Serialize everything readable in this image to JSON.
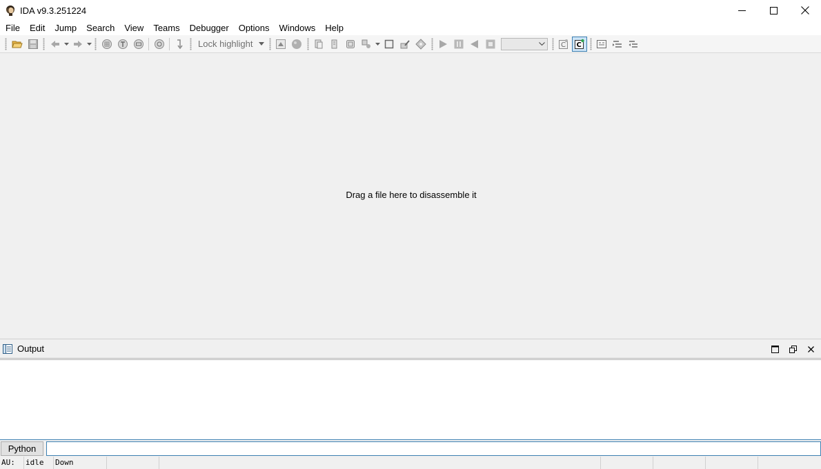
{
  "window": {
    "title": "IDA v9.3.251224",
    "minimize_icon": "minimize-icon",
    "maximize_icon": "maximize-icon",
    "close_icon": "close-icon"
  },
  "menu": {
    "items": [
      "File",
      "Edit",
      "Jump",
      "Search",
      "View",
      "Teams",
      "Debugger",
      "Options",
      "Windows",
      "Help"
    ]
  },
  "toolbar": {
    "lock_highlight_label": "Lock highlight",
    "debugger_combo_value": "",
    "icons": [
      "open-icon",
      "save-icon",
      "back-icon",
      "forward-icon",
      "graph-icon",
      "text-icon",
      "proximity-icon",
      "hex-icon",
      "step-icon",
      "navigate-up-icon",
      "record-icon",
      "run-icon",
      "pause-icon",
      "step-back-icon",
      "stop-icon",
      "decompile-icon",
      "pseudocode-icon",
      "outline-icon"
    ]
  },
  "main": {
    "drag_hint": "Drag a file here to disassemble it"
  },
  "output": {
    "title": "Output",
    "content": ""
  },
  "cli": {
    "language": "Python",
    "value": ""
  },
  "status": {
    "au_label": "AU:",
    "au_state": "idle",
    "direction": "Down"
  },
  "colors": {
    "accent": "#3c7fb1",
    "background": "#f0f0f0",
    "titlebar": "#ffffff"
  }
}
